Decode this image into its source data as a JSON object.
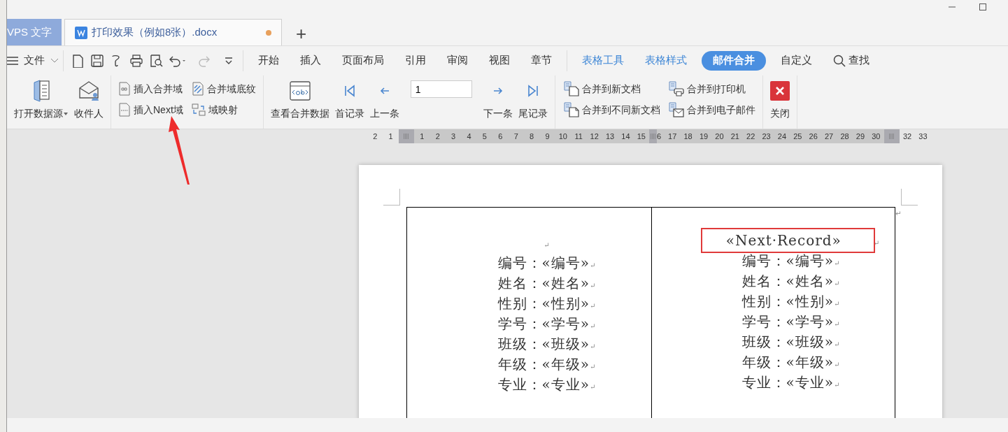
{
  "tabs": [
    {
      "label": "VPS 文字",
      "kind": "home",
      "selected": false,
      "unsaved": false
    },
    {
      "label": "打印效果（例如8张）.docx",
      "kind": "document",
      "selected": true,
      "unsaved": true
    }
  ],
  "new_tab": "+",
  "file_menu": "文件",
  "menu_tabs": [
    {
      "label": "开始",
      "kind": "normal",
      "selected": false
    },
    {
      "label": "插入",
      "kind": "normal",
      "selected": false
    },
    {
      "label": "页面布局",
      "kind": "normal",
      "selected": false
    },
    {
      "label": "引用",
      "kind": "normal",
      "selected": false
    },
    {
      "label": "审阅",
      "kind": "normal",
      "selected": false
    },
    {
      "label": "视图",
      "kind": "normal",
      "selected": false
    },
    {
      "label": "章节",
      "kind": "normal",
      "selected": false
    },
    {
      "label": "表格工具",
      "kind": "context",
      "selected": false
    },
    {
      "label": "表格样式",
      "kind": "context",
      "selected": false
    },
    {
      "label": "邮件合并",
      "kind": "normal",
      "selected": true
    },
    {
      "label": "自定义",
      "kind": "normal",
      "selected": false
    },
    {
      "label": "查找",
      "kind": "search",
      "selected": false
    }
  ],
  "ribbon": {
    "groups": [
      {
        "items": [
          {
            "kind": "large",
            "label": "打开数据源",
            "dropdown": true
          },
          {
            "kind": "large",
            "label": "收件人",
            "dropdown": false
          }
        ]
      },
      {
        "items": [
          {
            "kind": "small",
            "label": "插入合并域"
          },
          {
            "kind": "small",
            "label": "插入Next域"
          },
          {
            "kind": "small",
            "label": "合并域底纹"
          },
          {
            "kind": "small",
            "label": "域映射"
          }
        ]
      },
      {
        "items": [
          {
            "kind": "large",
            "label": "查看合并数据",
            "dropdown": false
          },
          {
            "kind": "large",
            "label": "首记录",
            "dropdown": false
          },
          {
            "kind": "large",
            "label": "上一条",
            "dropdown": false
          },
          {
            "kind": "input",
            "value": "1"
          },
          {
            "kind": "large",
            "label": "下一条",
            "dropdown": false
          },
          {
            "kind": "large",
            "label": "尾记录",
            "dropdown": false
          }
        ]
      },
      {
        "items": [
          {
            "kind": "small",
            "label": "合并到新文档"
          },
          {
            "kind": "small",
            "label": "合并到不同新文档"
          },
          {
            "kind": "small",
            "label": "合并到打印机"
          },
          {
            "kind": "small",
            "label": "合并到电子邮件"
          }
        ]
      },
      {
        "items": [
          {
            "kind": "large",
            "label": "关闭",
            "dropdown": false
          }
        ]
      }
    ]
  },
  "ruler": [
    {
      "kind": "number",
      "label": "2"
    },
    {
      "kind": "number",
      "label": "1"
    },
    {
      "kind": "margin"
    },
    {
      "kind": "number",
      "label": "1"
    },
    {
      "kind": "number",
      "label": "2"
    },
    {
      "kind": "number",
      "label": "3"
    },
    {
      "kind": "number",
      "label": "4"
    },
    {
      "kind": "number",
      "label": "5"
    },
    {
      "kind": "number",
      "label": "6"
    },
    {
      "kind": "number",
      "label": "7"
    },
    {
      "kind": "number",
      "label": "8"
    },
    {
      "kind": "number",
      "label": "9"
    },
    {
      "kind": "number",
      "label": "10"
    },
    {
      "kind": "number",
      "label": "11"
    },
    {
      "kind": "number",
      "label": "12"
    },
    {
      "kind": "number",
      "label": "13"
    },
    {
      "kind": "number",
      "label": "14"
    },
    {
      "kind": "number",
      "label": "15"
    },
    {
      "kind": "column"
    },
    {
      "kind": "number",
      "label": "6",
      "narrow": true
    },
    {
      "kind": "number",
      "label": "17"
    },
    {
      "kind": "number",
      "label": "18"
    },
    {
      "kind": "number",
      "label": "19"
    },
    {
      "kind": "number",
      "label": "20"
    },
    {
      "kind": "number",
      "label": "21"
    },
    {
      "kind": "number",
      "label": "22"
    },
    {
      "kind": "number",
      "label": "23"
    },
    {
      "kind": "number",
      "label": "24"
    },
    {
      "kind": "number",
      "label": "25"
    },
    {
      "kind": "number",
      "label": "26"
    },
    {
      "kind": "number",
      "label": "27"
    },
    {
      "kind": "number",
      "label": "28"
    },
    {
      "kind": "number",
      "label": "29"
    },
    {
      "kind": "number",
      "label": "30"
    },
    {
      "kind": "margin"
    },
    {
      "kind": "number",
      "label": "32"
    },
    {
      "kind": "number",
      "label": "33"
    }
  ],
  "document": {
    "row_end_mark": "↵",
    "cells": [
      {
        "lines": [
          {
            "mark": "↵"
          },
          {
            "text": "编号：«编号»",
            "mark": "↵",
            "highlighted": false
          },
          {
            "text": "姓名：«姓名»",
            "mark": "↵",
            "highlighted": false
          },
          {
            "text": "性别：«性别»",
            "mark": "↵",
            "highlighted": false
          },
          {
            "text": "学号：«学号»",
            "mark": "↵",
            "highlighted": false
          },
          {
            "text": "班级：«班级»",
            "mark": "↵",
            "highlighted": false
          },
          {
            "text": "年级：«年级»",
            "mark": "↵",
            "highlighted": false
          },
          {
            "text": "专业：«专业»",
            "mark": "↵",
            "highlighted": false
          }
        ]
      },
      {
        "lines": [
          {
            "text": "«Next·Record»",
            "mark": "↵",
            "highlighted": true
          },
          {
            "text": "编号：«编号»",
            "mark": "↵",
            "highlighted": false
          },
          {
            "text": "姓名：«姓名»",
            "mark": "↵",
            "highlighted": false
          },
          {
            "text": "性别：«性别»",
            "mark": "↵",
            "highlighted": false
          },
          {
            "text": "学号：«学号»",
            "mark": "↵",
            "highlighted": false
          },
          {
            "text": "班级：«班级»",
            "mark": "↵",
            "highlighted": false
          },
          {
            "text": "年级：«年级»",
            "mark": "↵",
            "highlighted": false
          },
          {
            "text": "专业：«专业»",
            "mark": "↵",
            "highlighted": false
          }
        ]
      }
    ]
  }
}
